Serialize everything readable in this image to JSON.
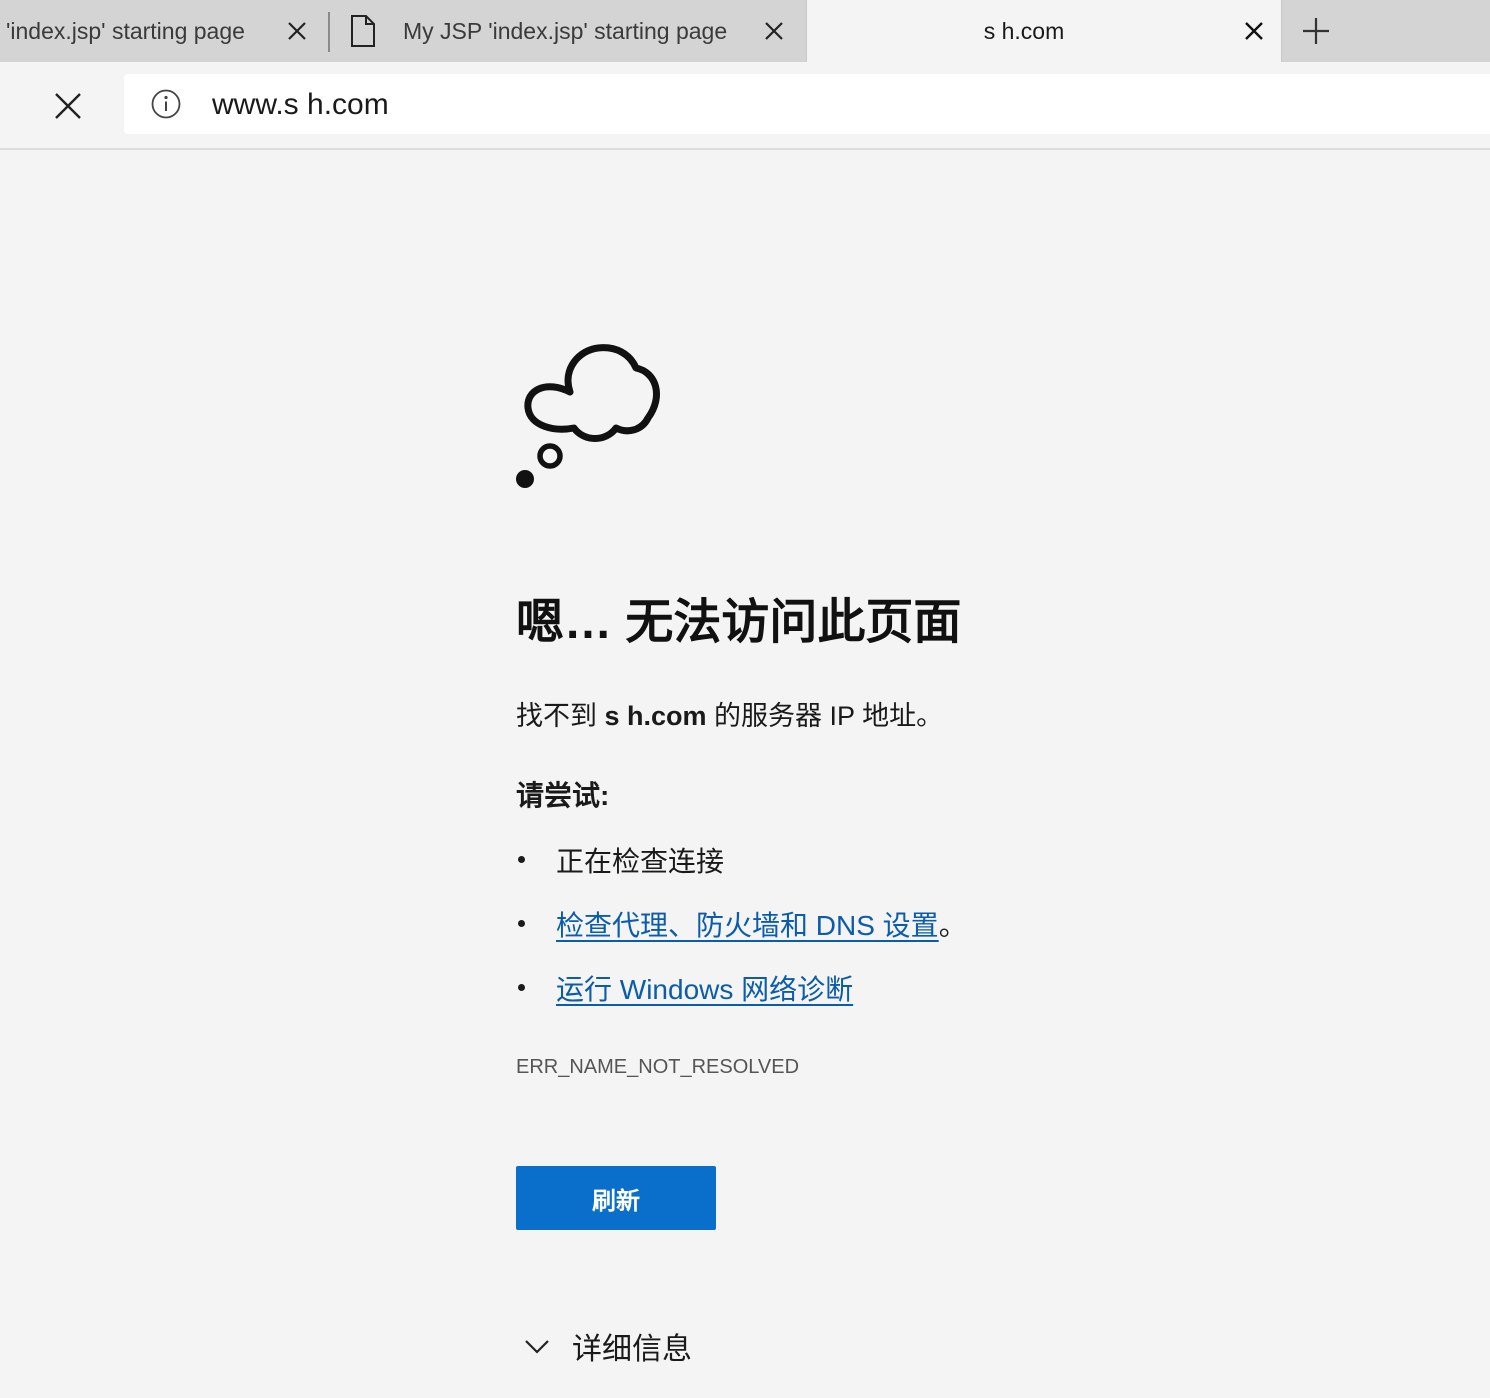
{
  "browser": {
    "tabs": [
      {
        "title": "'index.jsp' starting page",
        "icon": "close-icon"
      },
      {
        "title": "My JSP 'index.jsp' starting page",
        "icon": "document-icon"
      },
      {
        "title": "s      h.com",
        "active": true
      }
    ],
    "new_tab_icon": "plus-icon",
    "stop_icon": "close-icon",
    "address": "www.s        h.com"
  },
  "page": {
    "heading": "嗯… 无法访问此页面",
    "message_prefix": "找不到 ",
    "message_host": "s           h.com",
    "message_suffix": " 的服务器 IP 地址。",
    "try_label": "请尝试:",
    "suggestions": [
      {
        "text": "正在检查连接",
        "link": false
      },
      {
        "text": "检查代理、防火墙和 DNS 设置",
        "suffix": "。",
        "link": true
      },
      {
        "text": "运行 Windows 网络诊断",
        "link": true
      }
    ],
    "error_code": "ERR_NAME_NOT_RESOLVED",
    "refresh_label": "刷新",
    "details_label": "详细信息"
  },
  "colors": {
    "page_bg": "#f4f4f4",
    "tabstrip_bg": "#d4d4d4",
    "link": "#0b5cab",
    "button": "#0a6fca"
  }
}
